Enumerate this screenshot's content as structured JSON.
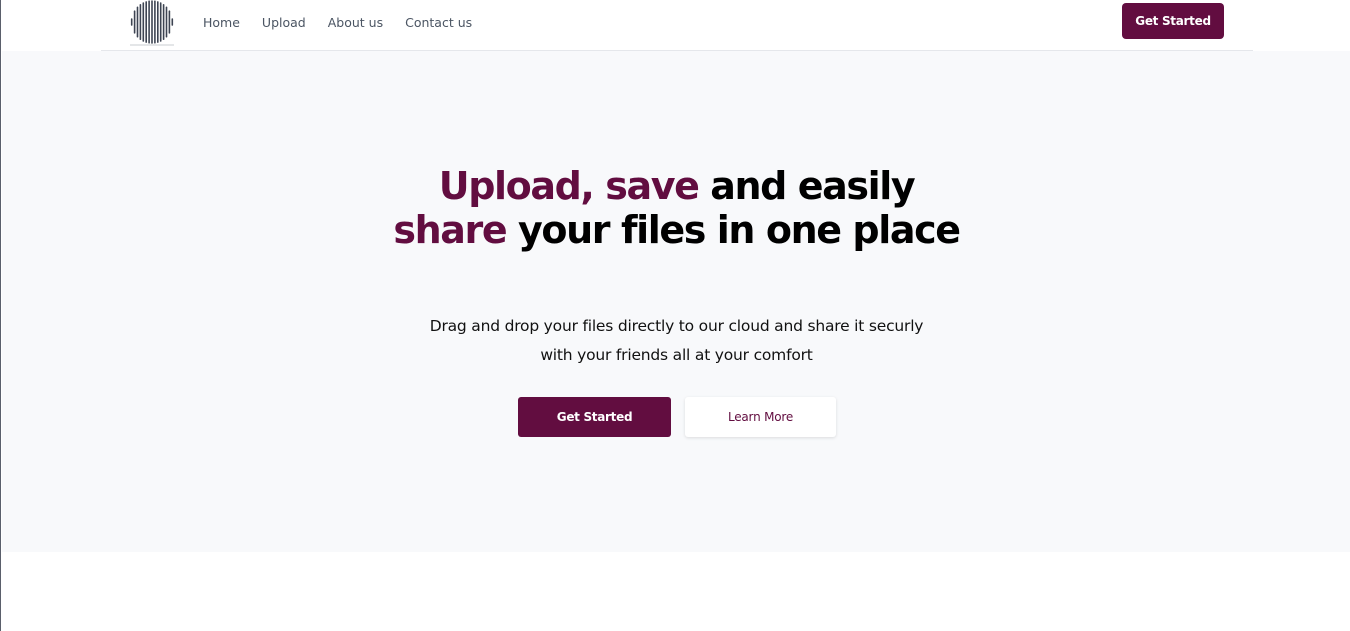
{
  "header": {
    "logo_icon": "soundwave-logo-icon",
    "nav": [
      {
        "label": "Home"
      },
      {
        "label": "Upload"
      },
      {
        "label": "About us"
      },
      {
        "label": "Contact us"
      }
    ],
    "cta_label": "Get Started"
  },
  "hero": {
    "title": {
      "accent1": "Upload, save",
      "part1": " and easily ",
      "accent2": "share",
      "part2": " your files in one place"
    },
    "subtitle_line1": "Drag and drop your files directly to our cloud and share it securly",
    "subtitle_line2": "with your friends all at your comfort",
    "primary_button": "Get Started",
    "secondary_button": "Learn More"
  },
  "colors": {
    "brand": "#620d40",
    "hero_background": "#f8f9fb",
    "nav_text": "#4b5563"
  }
}
